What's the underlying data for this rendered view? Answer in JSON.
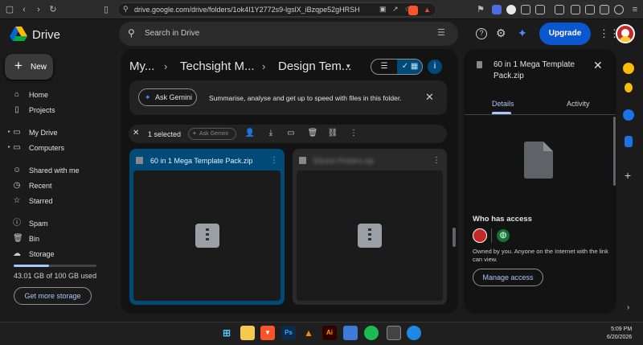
{
  "browser": {
    "url": "drive.google.com/drive/folders/1ok4I1Y2772s9-lgslX_iBzqpe52gHRSH"
  },
  "app": {
    "name": "Drive",
    "search_placeholder": "Search in Drive",
    "upgrade_label": "Upgrade"
  },
  "sidebar": {
    "new_label": "New",
    "items": [
      {
        "label": "Home",
        "icon": "home-icon"
      },
      {
        "label": "Projects",
        "icon": "file-icon"
      },
      {
        "label": "My Drive",
        "icon": "drive-icon"
      },
      {
        "label": "Computers",
        "icon": "computer-icon"
      },
      {
        "label": "Shared with me",
        "icon": "people-icon"
      },
      {
        "label": "Recent",
        "icon": "clock-icon"
      },
      {
        "label": "Starred",
        "icon": "star-icon"
      },
      {
        "label": "Spam",
        "icon": "spam-icon"
      },
      {
        "label": "Bin",
        "icon": "bin-icon"
      },
      {
        "label": "Storage",
        "icon": "cloud-icon"
      }
    ],
    "storage_text": "43.01 GB of 100 GB used",
    "storage_used_fraction": 0.43,
    "get_storage_label": "Get more storage"
  },
  "breadcrumb": {
    "items": [
      "My...",
      "Techsight M...",
      "Design Tem..."
    ]
  },
  "gemini": {
    "button_label": "Ask Gemini",
    "description": "Summarise, analyse and get up to speed with files in this folder."
  },
  "selection": {
    "count_label": "1 selected",
    "gemini_label": "Ask Gemini"
  },
  "files": [
    {
      "name": "60 in 1 Mega Template Pack.zip",
      "selected": true
    },
    {
      "name": "Elector Posters.zip",
      "selected": false
    }
  ],
  "details": {
    "title": "60 in 1 Mega Template Pack.zip",
    "tabs": [
      "Details",
      "Activity"
    ],
    "access_heading": "Who has access",
    "access_text": "Owned by you. Anyone on the Internet with the link can view.",
    "manage_label": "Manage access"
  },
  "taskbar": {
    "time": "5:09 PM",
    "date": "6/20/2026"
  },
  "colors": {
    "accent": "#0b57d0",
    "selected_card": "#004a77",
    "link": "#a8c7fa"
  }
}
